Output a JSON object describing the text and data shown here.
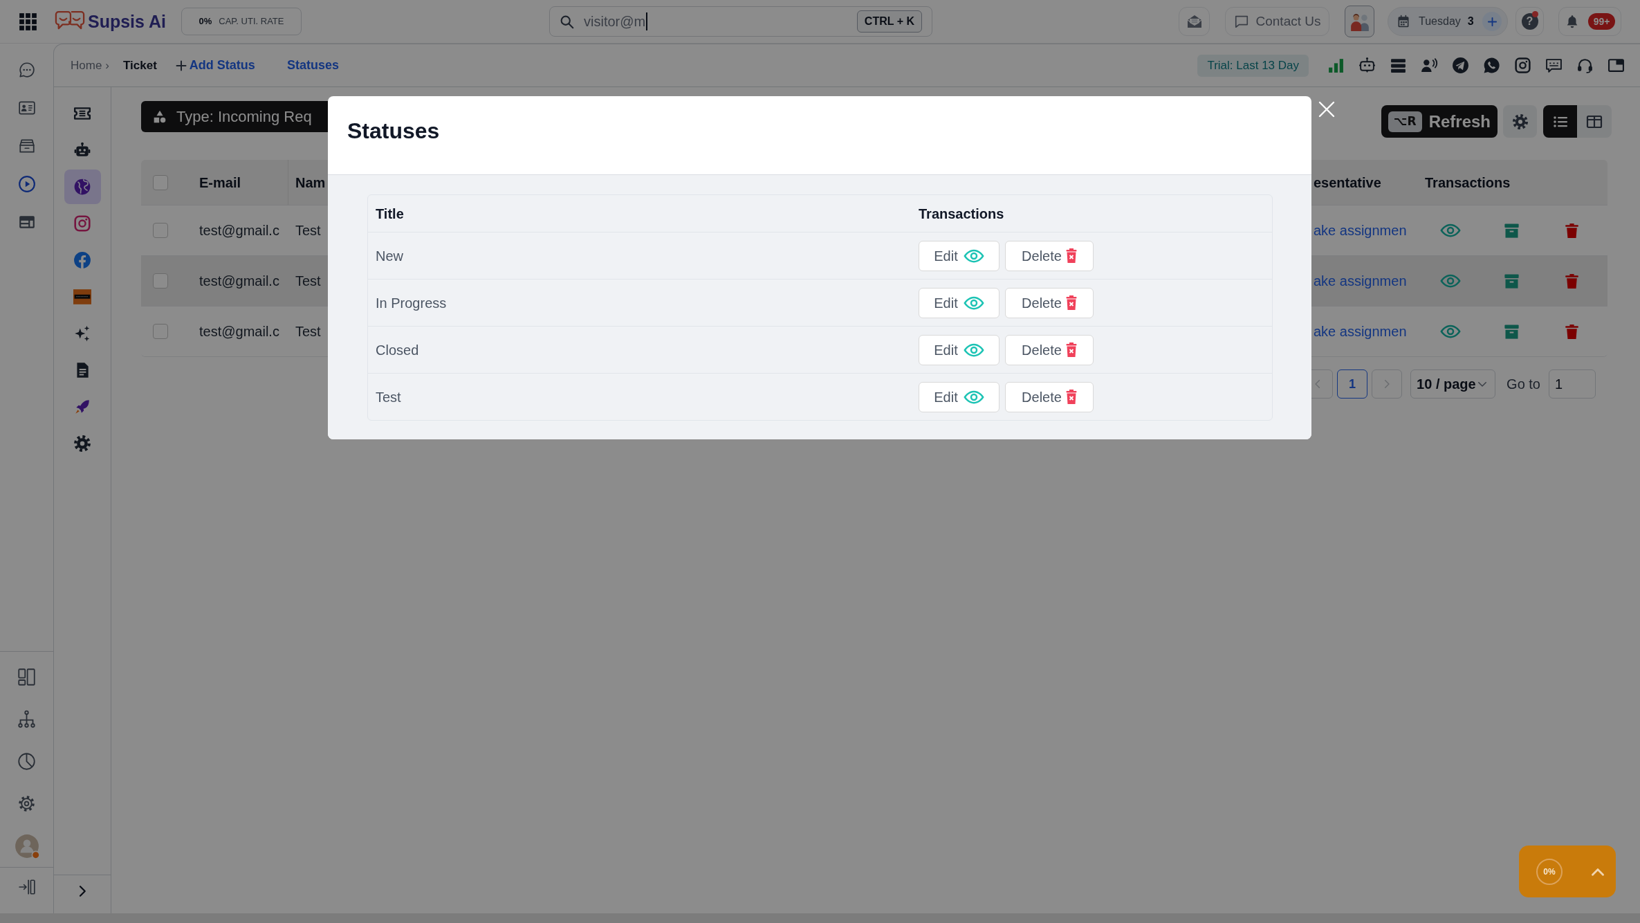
{
  "topbar": {
    "logo": "Supsis Ai",
    "cap_rate": {
      "value": "0%",
      "label": "CAP. UTI. RATE"
    },
    "search": {
      "value": "visitor@m",
      "shortcut": "CTRL + K"
    },
    "contact_button": "Contact Us",
    "date": {
      "day": "Tuesday",
      "number": "3"
    },
    "help": "?",
    "notification_count": "99+"
  },
  "nav_rail": {
    "items": [
      {
        "selected": false
      },
      {
        "selected": false
      },
      {
        "selected": false
      },
      {
        "selected": true
      },
      {
        "selected": false
      }
    ]
  },
  "channel_rail": {
    "items": [
      {
        "selected": false
      },
      {
        "selected": false
      },
      {
        "selected": true
      },
      {
        "selected": false
      },
      {
        "selected": false
      },
      {
        "selected": false
      },
      {
        "selected": false
      },
      {
        "selected": false
      },
      {
        "selected": false
      },
      {
        "selected": false
      }
    ]
  },
  "breadcrumb": {
    "items": [
      "Home",
      "Ticket"
    ],
    "separator": "›",
    "add_status_link": "Add Status",
    "statuses_link": "Statuses"
  },
  "trial_badge": "Trial: Last 13 Day",
  "filter_button": "Type: Incoming Req",
  "refresh_button": {
    "shortcut": "⌥R",
    "label": "Refresh"
  },
  "view_toggle": [
    {
      "selected": true
    },
    {
      "selected": false
    }
  ],
  "table": {
    "columns": [
      "E-mail",
      "Nam",
      "esentative",
      "Transactions"
    ],
    "header_checked": false,
    "rows": [
      {
        "checked": false,
        "highlighted": false,
        "cells": [
          "test@gmail.c",
          "Test",
          "ake assignmen"
        ]
      },
      {
        "checked": false,
        "highlighted": true,
        "cells": [
          "test@gmail.c",
          "Test",
          "ake assignmen"
        ]
      },
      {
        "checked": false,
        "highlighted": false,
        "cells": [
          "test@gmail.c",
          "Test",
          "ake assignmen"
        ]
      }
    ]
  },
  "pagination": {
    "pages": [
      {
        "label": "1",
        "selected": true
      }
    ],
    "page_size": "10 / page",
    "goto_label": "Go to",
    "goto_value": "1"
  },
  "modal": {
    "title": "Statuses",
    "columns": [
      "Title",
      "Transactions"
    ],
    "rows": [
      {
        "title": "New",
        "edit": "Edit",
        "delete": "Delete"
      },
      {
        "title": "In Progress",
        "edit": "Edit",
        "delete": "Delete"
      },
      {
        "title": "Closed",
        "edit": "Edit",
        "delete": "Delete"
      },
      {
        "title": "Test",
        "edit": "Edit",
        "delete": "Delete"
      }
    ]
  },
  "progress_widget": {
    "percent": "0%"
  }
}
